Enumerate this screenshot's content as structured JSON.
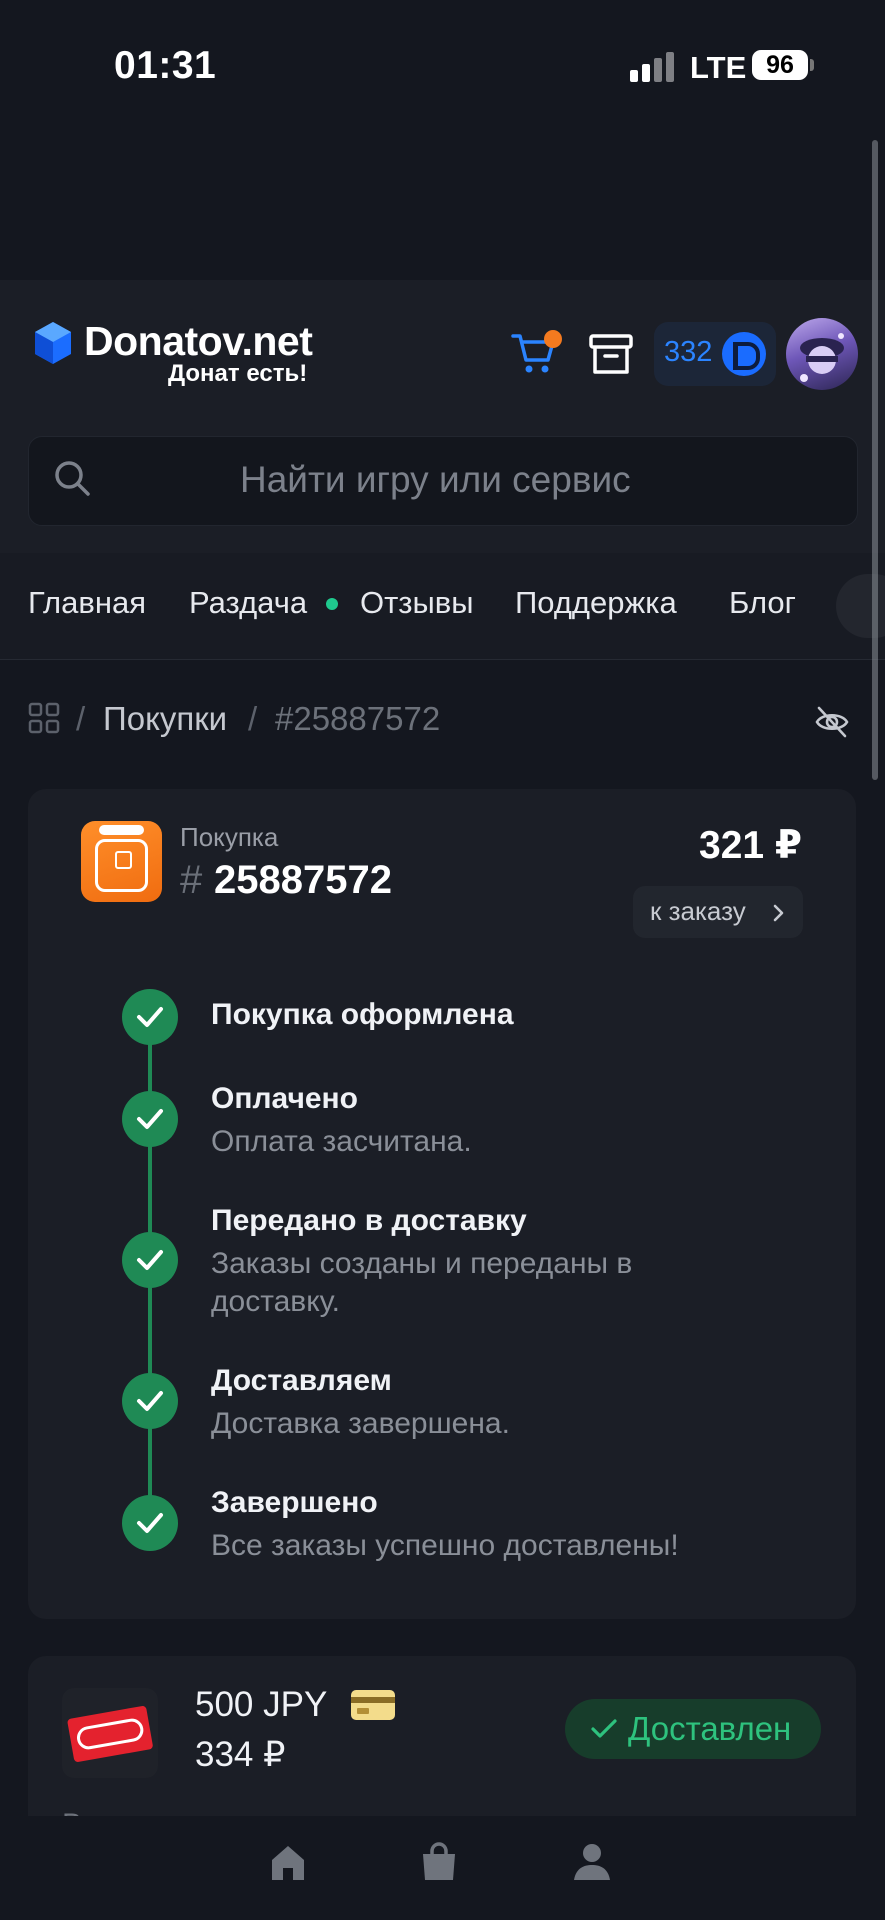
{
  "status_bar": {
    "time": "01:31",
    "network": "LTE",
    "battery": "96"
  },
  "header": {
    "brand": "Donatov.net",
    "tagline": "Донат есть!",
    "balance": "332",
    "search_placeholder": "Найти игру или сервис"
  },
  "nav": {
    "items": [
      "Главная",
      "Раздача",
      "Отзывы",
      "Поддержка",
      "Блог"
    ]
  },
  "breadcrumb": {
    "separator": "/",
    "section": "Покупки",
    "current": "#25887572"
  },
  "purchase": {
    "label": "Покупка",
    "hash": "#",
    "number": "25887572",
    "price": "321 ₽",
    "to_order_label": "к заказу",
    "steps": [
      {
        "title": "Покупка оформлена",
        "desc": ""
      },
      {
        "title": "Оплачено",
        "desc": "Оплата засчитана."
      },
      {
        "title": "Передано в доставку",
        "desc": "Заказы созданы и переданы в доставку."
      },
      {
        "title": "Доставляем",
        "desc": "Доставка завершена."
      },
      {
        "title": "Завершено",
        "desc": "Все заказы успешно доставлены!"
      }
    ]
  },
  "order_item": {
    "title": "500 JPY",
    "price": "334 ₽",
    "status": "Доставлен",
    "cut_label": "Ваш код"
  },
  "colors": {
    "accent": "#2b84ff",
    "success": "#1f8a55",
    "success_text": "#2ec27e",
    "notify": "#f47a1f",
    "background": "#14171f"
  },
  "icons": [
    "cart-icon",
    "archive-icon",
    "coin-icon",
    "search-icon",
    "grid-icon",
    "eye-off-icon",
    "chevron-right-icon",
    "check-icon",
    "home-icon",
    "bag-icon",
    "user-icon"
  ]
}
